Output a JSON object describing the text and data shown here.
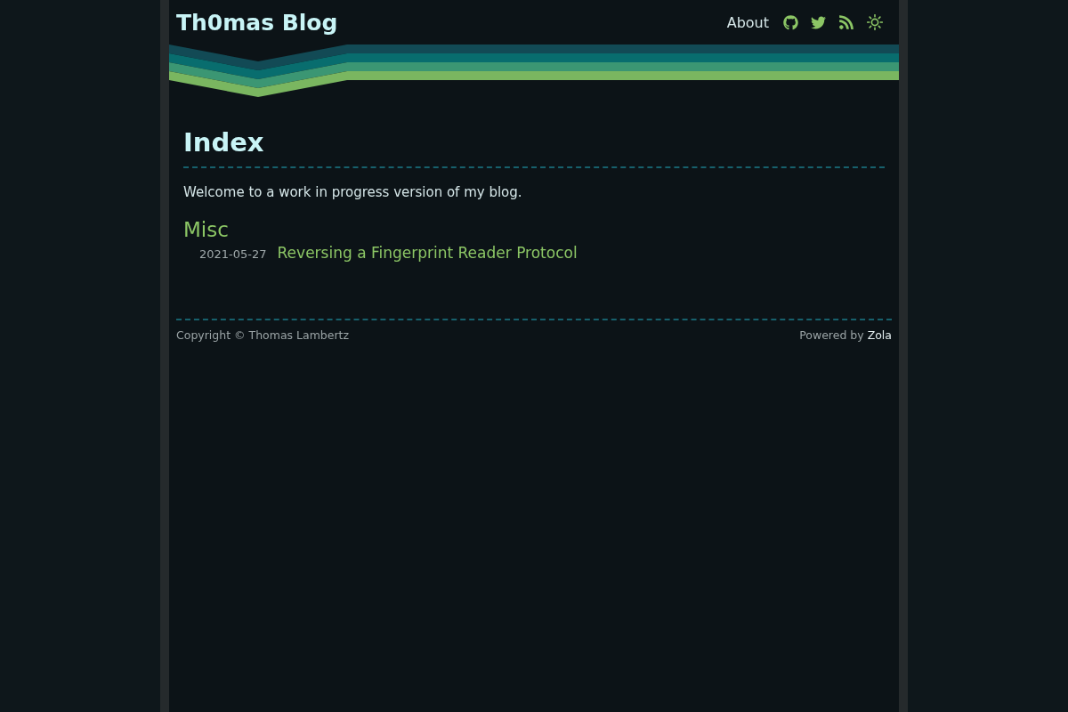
{
  "header": {
    "title": "Th0mas Blog",
    "nav_links": [
      "About"
    ]
  },
  "page": {
    "title": "Index",
    "intro": "Welcome to a work in progress version of my blog.",
    "sections": [
      {
        "title": "Misc",
        "posts": [
          {
            "date": "2021-05-27",
            "title": "Reversing a Fingerprint Reader Protocol"
          }
        ]
      }
    ]
  },
  "footer": {
    "copyright": "Copyright © Thomas Lambertz",
    "powered_by": "Powered by",
    "powered_link": "Zola"
  }
}
